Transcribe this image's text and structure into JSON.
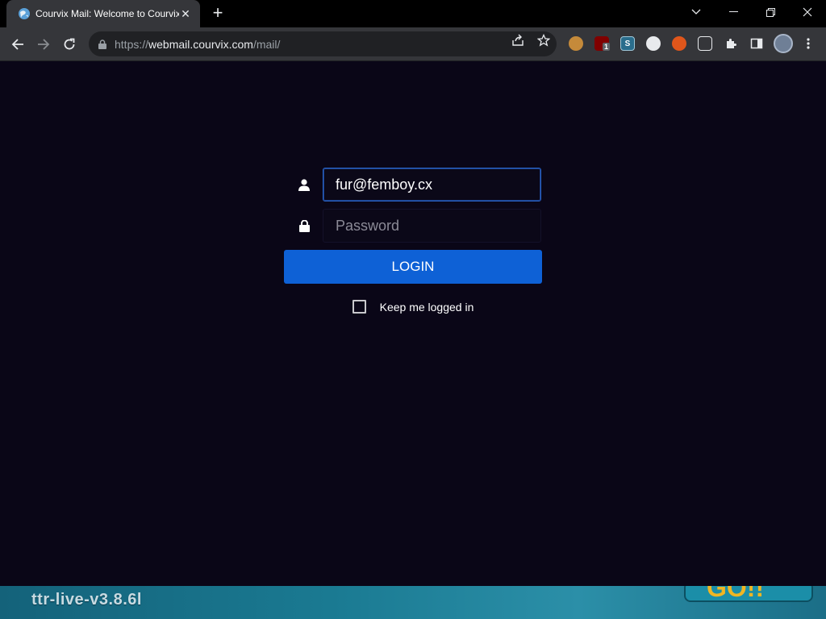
{
  "browser": {
    "tab_title": "Courvix Mail: Welcome to Courvix",
    "new_tab_icon": "plus-icon",
    "url_scheme": "https://",
    "url_host": "webmail.courvix.com",
    "url_path": "/mail/",
    "extensions": [
      "cookie-icon",
      "ublock-icon",
      "s-extension-icon",
      "dark-reader-icon",
      "fox-icon",
      "tamper-icon",
      "puzzle-icon",
      "sidebar-icon",
      "profile-avatar"
    ],
    "ublock_badge": "1"
  },
  "login": {
    "username_value": "fur@femboy.cx",
    "password_placeholder": "Password",
    "login_label": "LOGIN",
    "keep_logged_in_label": "Keep me logged in"
  },
  "banner": {
    "text": "ttr-live-v3.8.6l"
  },
  "colors": {
    "page_bg": "#0a0617",
    "button_blue": "#0e61d6",
    "focus_border": "#2a63c7"
  }
}
